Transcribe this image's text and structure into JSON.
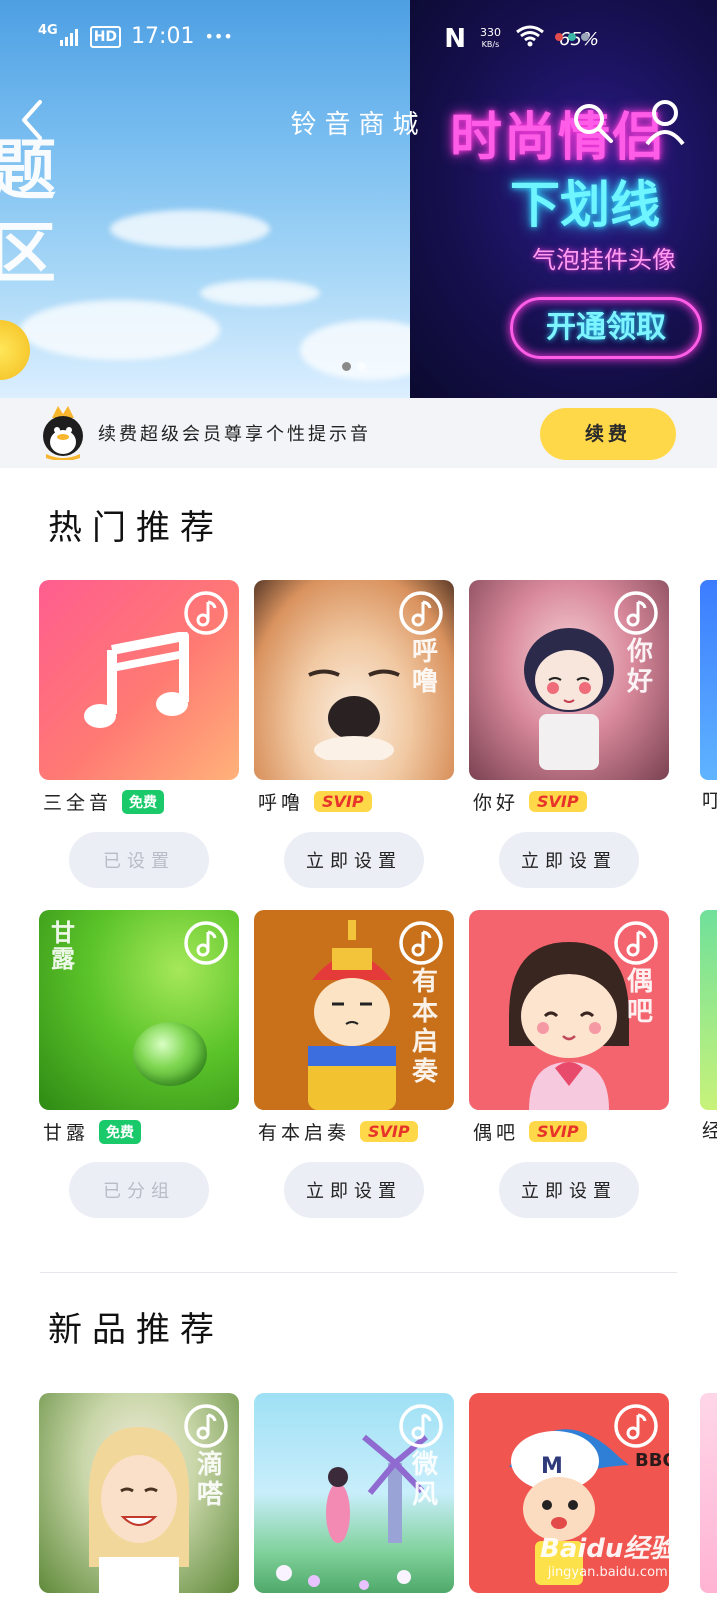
{
  "status_bar": {
    "network": "4G",
    "hd": "HD",
    "time": "17:01",
    "more": "•••",
    "nfc": "N",
    "speed_value": "330",
    "speed_unit": "KB/s",
    "battery": "65%"
  },
  "header": {
    "title": "铃音商城"
  },
  "banner": {
    "left_text_line1": "题",
    "left_text_line2": "区",
    "right_title": "时尚情侣",
    "right_subtitle": "下划线",
    "right_caption": "气泡挂件头像",
    "right_button": "开通领取",
    "slides_count": 2,
    "active_slide": 1
  },
  "vip": {
    "text": "续费超级会员尊享个性提示音",
    "button_label": "续费"
  },
  "hot_section": {
    "title": "热门推荐",
    "items": [
      {
        "name": "三全音",
        "badge": "免费",
        "badge_type": "free",
        "action": "已设置",
        "action_enabled": false,
        "overlay": ""
      },
      {
        "name": "呼噜",
        "badge": "SVIP",
        "badge_type": "svip",
        "action": "立即设置",
        "action_enabled": true,
        "overlay": "呼噜"
      },
      {
        "name": "你好",
        "badge": "SVIP",
        "badge_type": "svip",
        "action": "立即设置",
        "action_enabled": true,
        "overlay": "你好"
      },
      {
        "name": "甘露",
        "badge": "免费",
        "badge_type": "free",
        "action": "已分组",
        "action_enabled": false,
        "overlay": "甘露"
      },
      {
        "name": "有本启奏",
        "badge": "SVIP",
        "badge_type": "svip",
        "action": "立即设置",
        "action_enabled": true,
        "overlay": "有本启奏"
      },
      {
        "name": "偶吧",
        "badge": "SVIP",
        "badge_type": "svip",
        "action": "立即设置",
        "action_enabled": true,
        "overlay": "偶吧"
      }
    ],
    "peek_row1": "叮",
    "peek_row2": "经"
  },
  "new_section": {
    "title": "新品推荐",
    "overlays": [
      "滴嗒",
      "微风",
      "BBOX"
    ]
  },
  "watermark": {
    "brand": "Baidu经验",
    "url": "jingyan.baidu.com"
  },
  "colors": {
    "accent_yellow": "#ffd84a",
    "free_green": "#19c96a",
    "svip_red": "#e7342a"
  }
}
